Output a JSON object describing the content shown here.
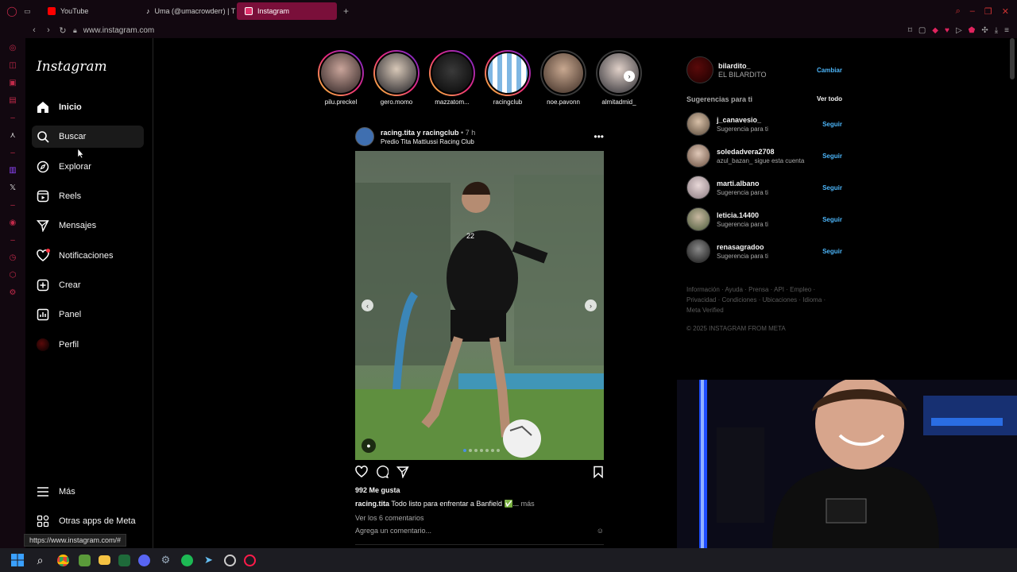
{
  "browser": {
    "tabs": [
      {
        "label": "YouTube",
        "favicon_color": "#ff0000"
      },
      {
        "label": "Uma (@umacrowderr) | T",
        "favicon_color": "#ffffff"
      },
      {
        "label": "Instagram",
        "favicon_color": "#e1306c"
      }
    ],
    "new_tab": "+",
    "url": "www.instagram.com",
    "status_url": "https://www.instagram.com/#"
  },
  "ig": {
    "logo": "Instagram",
    "nav": [
      {
        "label": "Inicio"
      },
      {
        "label": "Buscar"
      },
      {
        "label": "Explorar"
      },
      {
        "label": "Reels"
      },
      {
        "label": "Mensajes"
      },
      {
        "label": "Notificaciones"
      },
      {
        "label": "Crear"
      },
      {
        "label": "Panel"
      },
      {
        "label": "Perfil"
      }
    ],
    "nav_bottom": [
      {
        "label": "Más"
      },
      {
        "label": "Otras apps de Meta"
      }
    ]
  },
  "stories": [
    {
      "name": "pilu.preckel",
      "seen": false
    },
    {
      "name": "gero.momo",
      "seen": false
    },
    {
      "name": "mazzatom...",
      "seen": false
    },
    {
      "name": "racingclub",
      "seen": false
    },
    {
      "name": "noe.pavonn",
      "seen": true
    },
    {
      "name": "almitadmid_",
      "seen": true
    }
  ],
  "post": {
    "user": "racing.tita y racingclub",
    "time": "• 7 h",
    "location": "Predio Tita Mattiussi Racing Club",
    "likes": "992 Me gusta",
    "caption_user": "racing.tita",
    "caption_text": "Todo listo para enfrentar a Banfield ✅...",
    "caption_more": "más",
    "comments_link": "Ver los 6 comentarios",
    "comment_placeholder": "Agrega un comentario...",
    "photo_number": "22"
  },
  "right": {
    "me_user": "bilardito_",
    "me_name": "EL BILARDITO",
    "switch": "Cambiar",
    "suggestions_title": "Sugerencias para ti",
    "see_all": "Ver todo",
    "suggestions": [
      {
        "user": "j_canavesio_",
        "sub": "Sugerencia para ti",
        "follow": "Seguir",
        "color": "#8a7a6a"
      },
      {
        "user": "soledadvera2708",
        "sub": "azul_bazan_ sigue esta cuenta",
        "follow": "Seguir",
        "color": "#a0857a"
      },
      {
        "user": "marti.albano",
        "sub": "Sugerencia para ti",
        "follow": "Seguir",
        "color": "#b9a8a8"
      },
      {
        "user": "leticia.14400",
        "sub": "Sugerencia para ti",
        "follow": "Seguir",
        "color": "#7a8a6a"
      },
      {
        "user": "renasagradoo",
        "sub": "Sugerencia para ti",
        "follow": "Seguir",
        "color": "#3a3a3a"
      }
    ],
    "footer_line1": "Información · Ayuda · Prensa · API · Empleo ·",
    "footer_line2": "Privacidad · Condiciones · Ubicaciones · Idioma ·",
    "footer_line3": "Meta Verified",
    "copyright": "© 2025 INSTAGRAM FROM META"
  }
}
